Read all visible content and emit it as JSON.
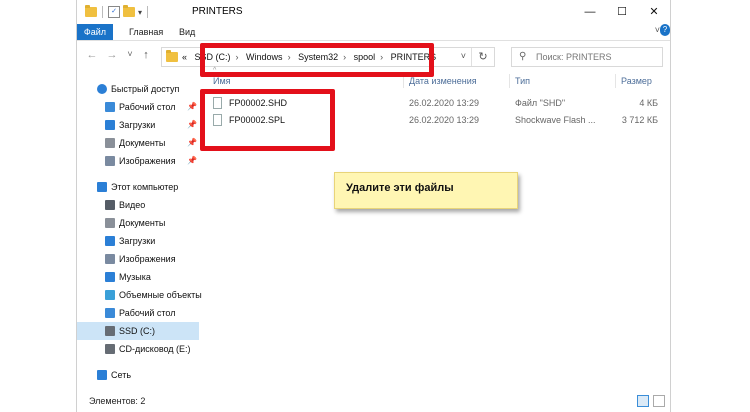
{
  "window": {
    "title": "PRINTERS",
    "minimize": "—",
    "maximize": "☐",
    "close": "✕"
  },
  "ribbon": {
    "tabs": [
      "Файл",
      "Главная",
      "Вид"
    ],
    "expand": "˅",
    "help": "?"
  },
  "nav": {
    "back": "←",
    "forward": "→",
    "recent": "˅",
    "up": "↑",
    "address": {
      "prefix": "«",
      "segments": [
        "SSD (C:)",
        "Windows",
        "System32",
        "spool",
        "PRINTERS"
      ],
      "separator": "›",
      "dropdown": "˅",
      "refresh": "↻"
    },
    "search_placeholder": "Поиск: PRINTERS"
  },
  "sidebar": {
    "items": [
      {
        "label": "Быстрый доступ",
        "icon": "star-icon",
        "color": "#2b7fd6",
        "level": 0,
        "pinned": false
      },
      {
        "label": "Рабочий стол",
        "icon": "desktop-icon",
        "color": "#3a8ad8",
        "level": 1,
        "pinned": true
      },
      {
        "label": "Загрузки",
        "icon": "download-icon",
        "color": "#2b7fd6",
        "level": 1,
        "pinned": true
      },
      {
        "label": "Документы",
        "icon": "document-icon",
        "color": "#8a9099",
        "level": 1,
        "pinned": true
      },
      {
        "label": "Изображения",
        "icon": "pictures-icon",
        "color": "#7a8aa0",
        "level": 1,
        "pinned": true
      },
      {
        "label": "Этот компьютер",
        "icon": "computer-icon",
        "color": "#2b7fd6",
        "level": 0,
        "pinned": false
      },
      {
        "label": "Видео",
        "icon": "video-icon",
        "color": "#555c66",
        "level": 1,
        "pinned": false
      },
      {
        "label": "Документы",
        "icon": "document-icon",
        "color": "#8a9099",
        "level": 1,
        "pinned": false
      },
      {
        "label": "Загрузки",
        "icon": "download-icon",
        "color": "#2b7fd6",
        "level": 1,
        "pinned": false
      },
      {
        "label": "Изображения",
        "icon": "pictures-icon",
        "color": "#7a8aa0",
        "level": 1,
        "pinned": false
      },
      {
        "label": "Музыка",
        "icon": "music-icon",
        "color": "#2b7fd6",
        "level": 1,
        "pinned": false
      },
      {
        "label": "Объемные объекты",
        "icon": "3d-objects-icon",
        "color": "#3aa0d8",
        "level": 1,
        "pinned": false
      },
      {
        "label": "Рабочий стол",
        "icon": "desktop-icon",
        "color": "#3a8ad8",
        "level": 1,
        "pinned": false
      },
      {
        "label": "SSD (C:)",
        "icon": "drive-icon",
        "color": "#666c74",
        "level": 1,
        "pinned": false,
        "selected": true
      },
      {
        "label": "CD-дисковод (E:)",
        "icon": "cd-drive-icon",
        "color": "#666c74",
        "level": 1,
        "pinned": false
      },
      {
        "label": "Сеть",
        "icon": "network-icon",
        "color": "#2b7fd6",
        "level": 0,
        "pinned": false
      }
    ],
    "pin_glyph": "📌"
  },
  "columns": {
    "name": "Имя",
    "date": "Дата изменения",
    "type": "Тип",
    "size": "Размер",
    "sort_glyph": "^"
  },
  "files": [
    {
      "name": "FP00002.SHD",
      "date": "26.02.2020 13:29",
      "type": "Файл \"SHD\"",
      "size": "4 КБ"
    },
    {
      "name": "FP00002.SPL",
      "date": "26.02.2020 13:29",
      "type": "Shockwave Flash ...",
      "size": "3 712 КБ"
    }
  ],
  "callout": {
    "text": "Удалите эти файлы"
  },
  "status": {
    "text": "Элементов: 2"
  },
  "colors": {
    "accent": "#1a73c8",
    "highlight": "#e3101a",
    "callout_bg": "#fff6b3",
    "selected": "#cce4f7"
  }
}
